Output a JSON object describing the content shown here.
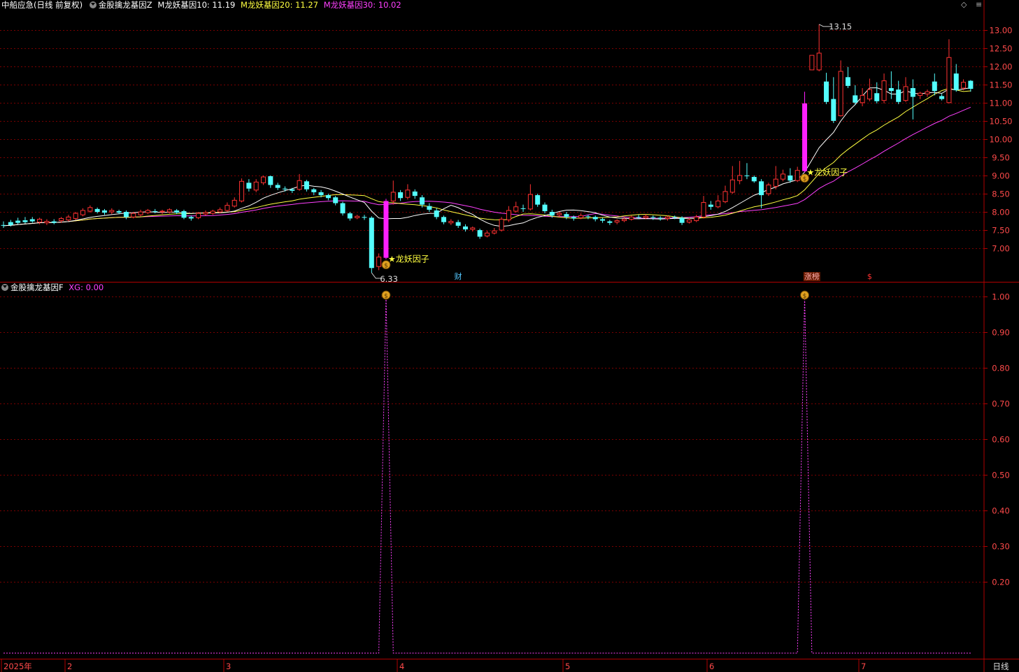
{
  "header": {
    "stock": "中船应急(日线 前复权)",
    "indicator_main": "金股擒龙基因Z",
    "ma10_label": "M龙妖基因10: 11.19",
    "ma20_label": "M龙妖基因20: 11.27",
    "ma30_label": "M龙妖基因30: 10.02",
    "sub_indicator": "金股擒龙基因F",
    "sub_value": "XG: 0.00",
    "buttons": [
      "◇",
      "≡"
    ]
  },
  "colors": {
    "up": "#ff3232",
    "down": "#54ffff",
    "signal_bar": "#ff20ff",
    "ma10": "#ffffff",
    "ma20": "#ffff40",
    "ma30": "#ff40ff",
    "grid": "#7a0000",
    "axis": "#b00000",
    "sub_line": "#ff40ff",
    "label": "#ffff40"
  },
  "chart_data": [
    {
      "type": "candlestick",
      "title": "中船应急(日线 前复权)",
      "y_ticks": [
        "13.00",
        "12.50",
        "12.00",
        "11.50",
        "11.00",
        "10.50",
        "10.00",
        "9.50",
        "9.00",
        "8.50",
        "8.00",
        "7.50",
        "7.00"
      ],
      "ylim": [
        6.1,
        13.55
      ],
      "candles": [
        [
          7.64,
          7.62,
          7.74,
          7.56
        ],
        [
          7.72,
          7.64,
          7.78,
          7.6
        ],
        [
          7.76,
          7.7,
          7.84,
          7.66
        ],
        [
          7.77,
          7.72,
          7.86,
          7.68
        ],
        [
          7.8,
          7.74,
          7.86,
          7.7
        ],
        [
          7.72,
          7.8,
          7.84,
          7.66
        ],
        [
          7.7,
          7.74,
          7.8,
          7.64
        ],
        [
          7.74,
          7.7,
          7.8,
          7.66
        ],
        [
          7.76,
          7.82,
          7.86,
          7.7
        ],
        [
          7.78,
          7.86,
          7.92,
          7.74
        ],
        [
          7.82,
          7.96,
          8.0,
          7.78
        ],
        [
          7.92,
          8.04,
          8.1,
          7.88
        ],
        [
          8.02,
          8.12,
          8.18,
          7.98
        ],
        [
          8.08,
          8.0,
          8.12,
          7.96
        ],
        [
          8.04,
          7.98,
          8.08,
          7.92
        ],
        [
          8.0,
          8.04,
          8.1,
          7.94
        ],
        [
          8.02,
          7.98,
          8.06,
          7.94
        ],
        [
          8.0,
          7.86,
          8.04,
          7.8
        ],
        [
          7.86,
          7.96,
          8.0,
          7.82
        ],
        [
          7.92,
          8.0,
          8.06,
          7.88
        ],
        [
          7.98,
          8.04,
          8.08,
          7.94
        ],
        [
          8.02,
          8.0,
          8.08,
          7.96
        ],
        [
          8.0,
          8.02,
          8.06,
          7.94
        ],
        [
          8.0,
          8.06,
          8.1,
          7.96
        ],
        [
          8.04,
          7.98,
          8.08,
          7.94
        ],
        [
          8.02,
          7.84,
          8.06,
          7.8
        ],
        [
          7.86,
          7.82,
          7.9,
          7.76
        ],
        [
          7.84,
          7.96,
          8.0,
          7.8
        ],
        [
          7.94,
          7.98,
          8.04,
          7.9
        ],
        [
          7.96,
          8.02,
          8.06,
          7.92
        ],
        [
          8.0,
          8.06,
          8.12,
          7.96
        ],
        [
          8.04,
          8.18,
          8.26,
          8.0
        ],
        [
          8.16,
          8.32,
          8.4,
          8.12
        ],
        [
          8.3,
          8.84,
          8.92,
          8.26
        ],
        [
          8.8,
          8.64,
          8.9,
          8.56
        ],
        [
          8.6,
          8.82,
          8.9,
          8.54
        ],
        [
          8.8,
          8.96,
          9.0,
          8.74
        ],
        [
          8.98,
          8.74,
          9.0,
          8.66
        ],
        [
          8.74,
          8.66,
          8.8,
          8.6
        ],
        [
          8.64,
          8.62,
          8.7,
          8.56
        ],
        [
          8.62,
          8.58,
          8.66,
          8.52
        ],
        [
          8.62,
          8.86,
          9.04,
          8.58
        ],
        [
          8.84,
          8.62,
          8.88,
          8.56
        ],
        [
          8.62,
          8.54,
          8.66,
          8.46
        ],
        [
          8.54,
          8.46,
          8.6,
          8.4
        ],
        [
          8.46,
          8.38,
          8.5,
          8.32
        ],
        [
          8.4,
          8.24,
          8.44,
          8.18
        ],
        [
          8.24,
          7.96,
          8.28,
          7.9
        ],
        [
          7.96,
          7.82,
          8.0,
          7.76
        ],
        [
          7.84,
          7.88,
          7.92,
          7.8
        ],
        [
          7.86,
          7.84,
          7.92,
          7.78
        ],
        [
          7.84,
          6.46,
          7.88,
          6.33
        ],
        [
          6.5,
          6.76,
          6.86,
          6.4
        ],
        [
          6.74,
          8.3,
          8.36,
          6.7
        ],
        [
          8.3,
          8.54,
          8.86,
          8.2
        ],
        [
          8.54,
          8.38,
          8.6,
          8.3
        ],
        [
          8.4,
          8.6,
          8.76,
          8.34
        ],
        [
          8.56,
          8.44,
          8.62,
          8.36
        ],
        [
          8.4,
          8.2,
          8.46,
          8.12
        ],
        [
          8.16,
          8.06,
          8.24,
          8.0
        ],
        [
          8.04,
          7.86,
          8.1,
          7.8
        ],
        [
          7.86,
          7.72,
          7.9,
          7.66
        ],
        [
          7.7,
          7.74,
          7.8,
          7.64
        ],
        [
          7.72,
          7.62,
          7.78,
          7.56
        ],
        [
          7.6,
          7.52,
          7.66,
          7.46
        ],
        [
          7.52,
          7.56,
          7.6,
          7.46
        ],
        [
          7.5,
          7.32,
          7.54,
          7.26
        ],
        [
          7.34,
          7.42,
          7.48,
          7.3
        ],
        [
          7.42,
          7.48,
          7.56,
          7.38
        ],
        [
          7.5,
          7.8,
          7.86,
          7.46
        ],
        [
          7.78,
          8.04,
          8.16,
          7.72
        ],
        [
          8.02,
          8.14,
          8.28,
          7.98
        ],
        [
          8.1,
          8.08,
          8.2,
          8.0
        ],
        [
          8.08,
          8.48,
          8.76,
          8.04
        ],
        [
          8.46,
          8.2,
          8.5,
          8.14
        ],
        [
          8.2,
          8.02,
          8.26,
          7.96
        ],
        [
          8.0,
          7.9,
          8.06,
          7.84
        ],
        [
          7.92,
          7.96,
          8.0,
          7.86
        ],
        [
          7.94,
          7.86,
          8.0,
          7.8
        ],
        [
          7.86,
          7.82,
          7.9,
          7.76
        ],
        [
          7.84,
          7.9,
          7.96,
          7.8
        ],
        [
          7.88,
          7.86,
          7.92,
          7.8
        ],
        [
          7.86,
          7.8,
          7.9,
          7.74
        ],
        [
          7.8,
          7.76,
          7.84,
          7.7
        ],
        [
          7.74,
          7.7,
          7.78,
          7.64
        ],
        [
          7.72,
          7.76,
          7.8,
          7.66
        ],
        [
          7.76,
          7.8,
          7.86,
          7.72
        ],
        [
          7.8,
          7.86,
          7.9,
          7.76
        ],
        [
          7.86,
          7.84,
          7.92,
          7.8
        ],
        [
          7.84,
          7.88,
          7.94,
          7.8
        ],
        [
          7.86,
          7.84,
          7.9,
          7.78
        ],
        [
          7.84,
          7.82,
          7.88,
          7.76
        ],
        [
          7.82,
          7.86,
          7.9,
          7.76
        ],
        [
          7.86,
          7.84,
          7.9,
          7.8
        ],
        [
          7.84,
          7.7,
          7.88,
          7.64
        ],
        [
          7.72,
          7.78,
          7.84,
          7.68
        ],
        [
          7.76,
          7.86,
          7.92,
          7.72
        ],
        [
          7.86,
          8.26,
          8.44,
          7.82
        ],
        [
          8.2,
          8.14,
          8.3,
          8.06
        ],
        [
          8.14,
          8.3,
          8.46,
          8.1
        ],
        [
          8.28,
          8.56,
          8.72,
          8.24
        ],
        [
          8.54,
          8.88,
          9.26,
          8.5
        ],
        [
          8.86,
          9.0,
          9.4,
          8.76
        ],
        [
          9.0,
          8.98,
          9.34,
          8.9
        ],
        [
          8.96,
          8.84,
          9.0,
          8.8
        ],
        [
          8.84,
          8.46,
          8.9,
          8.1
        ],
        [
          8.5,
          8.74,
          8.8,
          8.44
        ],
        [
          8.7,
          8.9,
          9.26,
          8.62
        ],
        [
          8.9,
          9.04,
          9.16,
          8.84
        ],
        [
          9.0,
          8.86,
          9.2,
          8.8
        ],
        [
          8.86,
          9.14,
          9.24,
          8.82
        ],
        [
          9.12,
          10.98,
          11.3,
          9.08
        ],
        [
          11.9,
          12.3,
          12.3,
          11.9
        ],
        [
          11.9,
          12.36,
          13.15,
          11.86
        ],
        [
          11.58,
          11.02,
          11.82,
          10.96
        ],
        [
          11.1,
          10.5,
          11.7,
          10.44
        ],
        [
          10.64,
          11.86,
          12.16,
          10.62
        ],
        [
          11.7,
          11.46,
          11.98,
          11.4
        ],
        [
          11.2,
          11.0,
          11.48,
          10.94
        ],
        [
          11.0,
          11.2,
          11.4,
          10.9
        ],
        [
          11.1,
          11.36,
          11.66,
          11.04
        ],
        [
          11.26,
          11.04,
          11.56,
          10.98
        ],
        [
          11.06,
          11.6,
          11.8,
          10.98
        ],
        [
          11.4,
          11.32,
          11.86,
          11.1
        ],
        [
          11.36,
          11.02,
          11.6,
          10.96
        ],
        [
          11.06,
          11.44,
          11.7,
          11.02
        ],
        [
          11.4,
          11.16,
          11.64,
          10.54
        ],
        [
          11.2,
          11.26,
          11.3,
          11.1
        ],
        [
          11.24,
          11.3,
          11.36,
          11.16
        ],
        [
          11.58,
          11.32,
          11.8,
          11.2
        ],
        [
          11.18,
          11.1,
          11.24,
          11.06
        ],
        [
          11.0,
          12.24,
          12.74,
          10.98
        ],
        [
          11.8,
          11.34,
          12.06,
          11.3
        ],
        [
          11.4,
          11.56,
          11.64,
          11.34
        ],
        [
          11.6,
          11.38,
          11.62,
          11.3
        ]
      ],
      "signal_days": [
        53,
        111
      ],
      "signal_label": "★龙妖因子",
      "low_label": "6.33",
      "high_label": "13.15",
      "event_tags": [
        "财",
        "涨榜",
        "$"
      ]
    },
    {
      "type": "line",
      "title": "金股擒龙基因F",
      "series": [
        {
          "name": "XG",
          "values_at_signal": 1,
          "values_else": 0
        }
      ],
      "y_ticks": [
        "1.00",
        "0.90",
        "0.80",
        "0.70",
        "0.60",
        "0.50",
        "0.40",
        "0.30",
        "0.20"
      ],
      "ylim": [
        0,
        1.0
      ]
    }
  ],
  "x_axis": {
    "labels": [
      "2025年",
      "2",
      "3",
      "4",
      "5",
      "6",
      "7"
    ],
    "period": "日线"
  }
}
